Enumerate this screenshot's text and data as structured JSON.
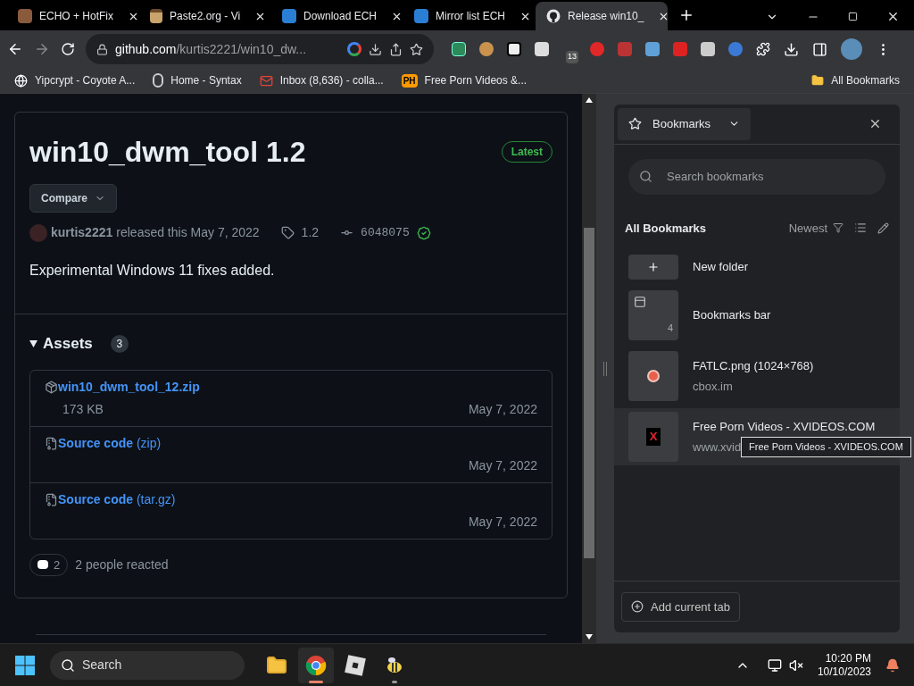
{
  "tabs": [
    {
      "title": "ECHO + HotFix",
      "selected": false,
      "kind": "photo"
    },
    {
      "title": "Paste2.org - Vi",
      "selected": false,
      "kind": "clipboard"
    },
    {
      "title": "Download ECH",
      "selected": false,
      "kind": "box"
    },
    {
      "title": "Mirror list ECH",
      "selected": false,
      "kind": "box"
    },
    {
      "title": "Release win10_",
      "selected": true,
      "kind": "cat"
    }
  ],
  "address": {
    "host": "github.com",
    "path": "/kurtis2221/win10_dw..."
  },
  "extension_badge": "13",
  "bookmarks_bar": {
    "items": [
      {
        "label": "Yipcrypt - Coyote A...",
        "kind": "globe"
      },
      {
        "label": "Home - Syntax",
        "kind": "letter"
      },
      {
        "label": "Inbox (8,636) - colla...",
        "kind": "mail"
      },
      {
        "label": "Free Porn Videos &...",
        "kind": "badge",
        "badge": "PH"
      }
    ],
    "all_label": "All Bookmarks"
  },
  "release": {
    "title": "win10_dwm_tool 1.2",
    "badge": "Latest",
    "compare": "Compare",
    "author": "kurtis2221",
    "released": "released this May 7, 2022",
    "tag": "1.2",
    "commit": "6048075",
    "verified": true,
    "body": "Experimental Windows 11 fixes added.",
    "assets_title": "Assets",
    "assets_count": "3",
    "assets": [
      {
        "kind": "package",
        "name": "win10_dwm_tool_12.zip",
        "size": "173 KB",
        "date": "May 7, 2022"
      },
      {
        "kind": "source",
        "name": "Source code",
        "suffix": "(zip)",
        "date": "May 7, 2022"
      },
      {
        "kind": "source",
        "name": "Source code",
        "suffix": "(tar.gz)",
        "date": "May 7, 2022"
      }
    ],
    "reaction_count": "2",
    "reaction_text": "2 people reacted"
  },
  "panel": {
    "title": "Bookmarks",
    "search_placeholder": "Search bookmarks",
    "heading": "All Bookmarks",
    "sort": "Newest",
    "items": [
      {
        "kind": "new",
        "title": "New folder",
        "highlighted": false
      },
      {
        "kind": "folder",
        "title": "Bookmarks bar",
        "count": "4",
        "highlighted": false
      },
      {
        "kind": "image-site",
        "title": "FATLC.png (1024×768)",
        "url": "cbox.im",
        "highlighted": false
      },
      {
        "kind": "letter-site",
        "title": "Free Porn Videos - XVIDEOS.COM",
        "url": "www.xvid",
        "glyph": "X",
        "highlighted": true
      }
    ],
    "tooltip": "Free Porn Videos - XVIDEOS.COM",
    "add_button": "Add current tab"
  },
  "taskbar": {
    "search_placeholder": "Search",
    "apps": [
      {
        "kind": "folder",
        "running": false
      },
      {
        "kind": "chrome",
        "running": true
      },
      {
        "kind": "roblox",
        "running": false
      },
      {
        "kind": "bee",
        "running": true
      }
    ],
    "time": "10:20 PM",
    "date": "10/10/2023"
  }
}
